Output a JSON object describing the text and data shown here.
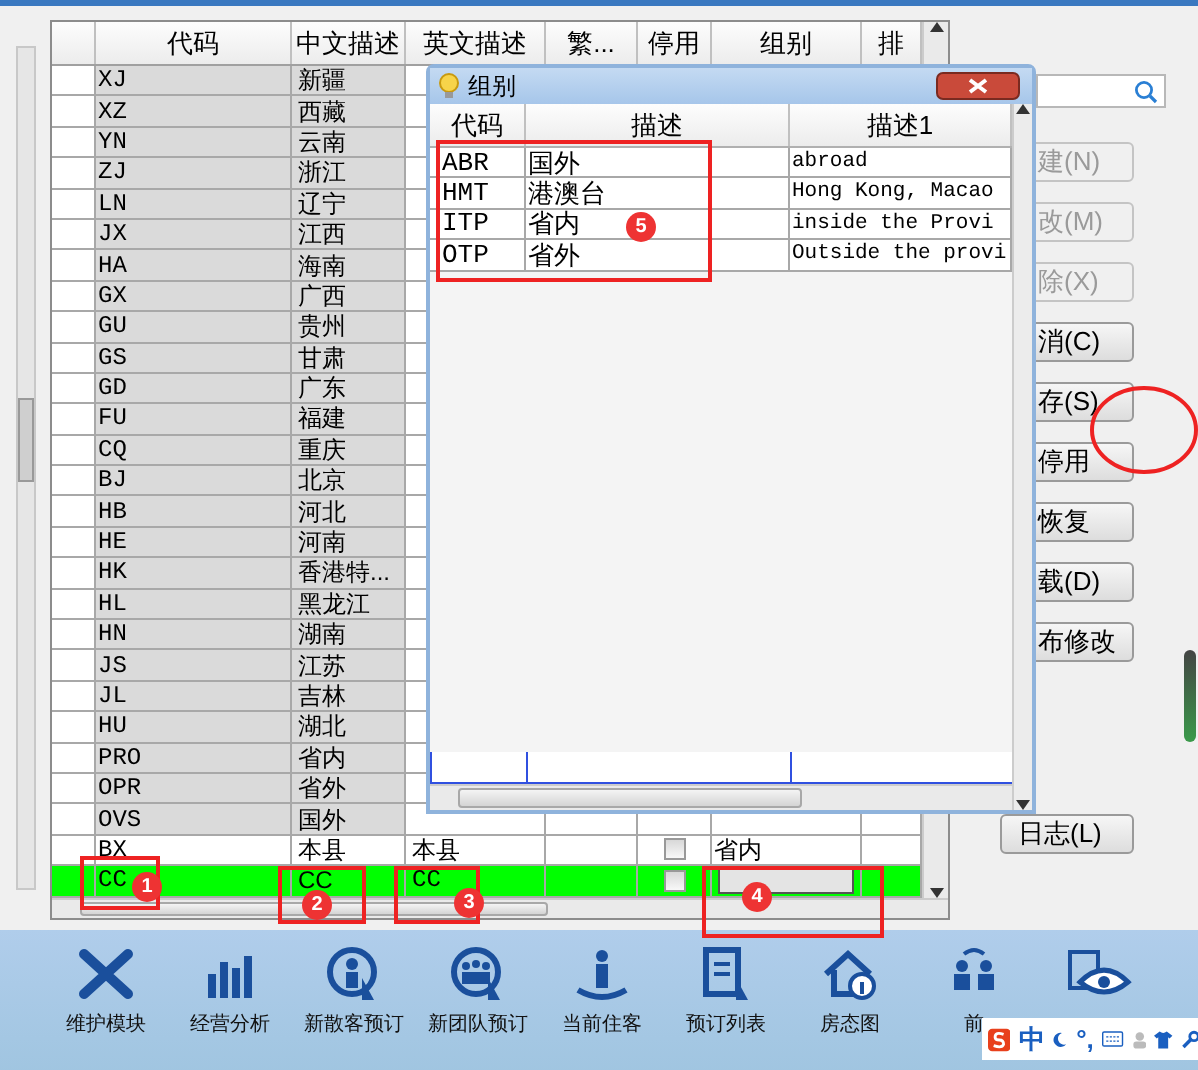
{
  "table": {
    "columns": [
      "代码",
      "中文描述",
      "英文描述",
      "繁...",
      "停用",
      "组别",
      "排"
    ],
    "rows": [
      {
        "code": "XJ",
        "zh": "新疆",
        "shaded": true,
        "selected": false
      },
      {
        "code": "XZ",
        "zh": "西藏",
        "shaded": true,
        "selected": false
      },
      {
        "code": "YN",
        "zh": "云南",
        "shaded": true,
        "selected": false
      },
      {
        "code": "ZJ",
        "zh": "浙江",
        "shaded": true,
        "selected": false
      },
      {
        "code": "LN",
        "zh": "辽宁",
        "shaded": true,
        "selected": false
      },
      {
        "code": "JX",
        "zh": "江西",
        "shaded": true,
        "selected": false
      },
      {
        "code": "HA",
        "zh": "海南",
        "shaded": true,
        "selected": false
      },
      {
        "code": "GX",
        "zh": "广西",
        "shaded": true,
        "selected": false
      },
      {
        "code": "GU",
        "zh": "贵州",
        "shaded": true,
        "selected": false
      },
      {
        "code": "GS",
        "zh": "甘肃",
        "shaded": true,
        "selected": false
      },
      {
        "code": "GD",
        "zh": "广东",
        "shaded": true,
        "selected": false
      },
      {
        "code": "FU",
        "zh": "福建",
        "shaded": true,
        "selected": false
      },
      {
        "code": "CQ",
        "zh": "重庆",
        "shaded": true,
        "selected": false
      },
      {
        "code": "BJ",
        "zh": "北京",
        "shaded": true,
        "selected": false
      },
      {
        "code": "HB",
        "zh": "河北",
        "shaded": true,
        "selected": false
      },
      {
        "code": "HE",
        "zh": "河南",
        "shaded": true,
        "selected": false
      },
      {
        "code": "HK",
        "zh": "香港特...",
        "shaded": true,
        "selected": false
      },
      {
        "code": "HL",
        "zh": "黑龙江",
        "shaded": true,
        "selected": false
      },
      {
        "code": "HN",
        "zh": "湖南",
        "shaded": true,
        "selected": false
      },
      {
        "code": "JS",
        "zh": "江苏",
        "shaded": true,
        "selected": false
      },
      {
        "code": "JL",
        "zh": "吉林",
        "shaded": true,
        "selected": false
      },
      {
        "code": "HU",
        "zh": "湖北",
        "shaded": true,
        "selected": false
      },
      {
        "code": "PRO",
        "zh": "省内",
        "shaded": true,
        "selected": false
      },
      {
        "code": "OPR",
        "zh": "省外",
        "shaded": true,
        "selected": false
      },
      {
        "code": "OVS",
        "zh": "国外",
        "shaded": true,
        "selected": false
      },
      {
        "code": "BX",
        "zh": "本县",
        "en": "本县",
        "disabled": false,
        "group": "省内",
        "shaded": false,
        "selected": false
      },
      {
        "code": "CC",
        "zh": "CC",
        "en": "CC",
        "disabled": false,
        "shaded": false,
        "selected": true,
        "editing": true
      }
    ]
  },
  "buttons": [
    {
      "label": "建(N)",
      "disabled": true
    },
    {
      "label": "改(M)",
      "disabled": true
    },
    {
      "label": "除(X)",
      "disabled": true
    },
    {
      "label": "消(C)",
      "disabled": false
    },
    {
      "label": "存(S)",
      "disabled": false
    },
    {
      "label": "停用",
      "disabled": false
    },
    {
      "label": "恢复",
      "disabled": false
    },
    {
      "label": "载(D)",
      "disabled": false
    },
    {
      "label": "布修改",
      "disabled": false
    },
    {
      "label": "日志(L)",
      "disabled": false
    }
  ],
  "dialog": {
    "title": "组别",
    "columns": [
      "代码",
      "描述",
      "描述1"
    ],
    "rows": [
      {
        "code": "ABR",
        "desc": "国外",
        "desc1": "abroad"
      },
      {
        "code": "HMT",
        "desc": "港澳台",
        "desc1": "Hong Kong, Macao"
      },
      {
        "code": "ITP",
        "desc": "省内",
        "desc1": "inside the Provi"
      },
      {
        "code": "OTP",
        "desc": "省外",
        "desc1": "Outside the provi"
      }
    ]
  },
  "annotations": [
    {
      "number": "1"
    },
    {
      "number": "2"
    },
    {
      "number": "3"
    },
    {
      "number": "4"
    },
    {
      "number": "5"
    }
  ],
  "taskbar": [
    {
      "label": "维护模块",
      "kind": "tools"
    },
    {
      "label": "经营分析",
      "kind": "chart"
    },
    {
      "label": "新散客预订",
      "kind": "person"
    },
    {
      "label": "新团队预订",
      "kind": "group"
    },
    {
      "label": "当前住客",
      "kind": "guest"
    },
    {
      "label": "预订列表",
      "kind": "list"
    },
    {
      "label": "房态图",
      "kind": "house"
    },
    {
      "label": "前",
      "kind": "exchange"
    },
    {
      "kind": "eye"
    }
  ],
  "ime": {
    "language": "中",
    "punctuation": "°,"
  }
}
